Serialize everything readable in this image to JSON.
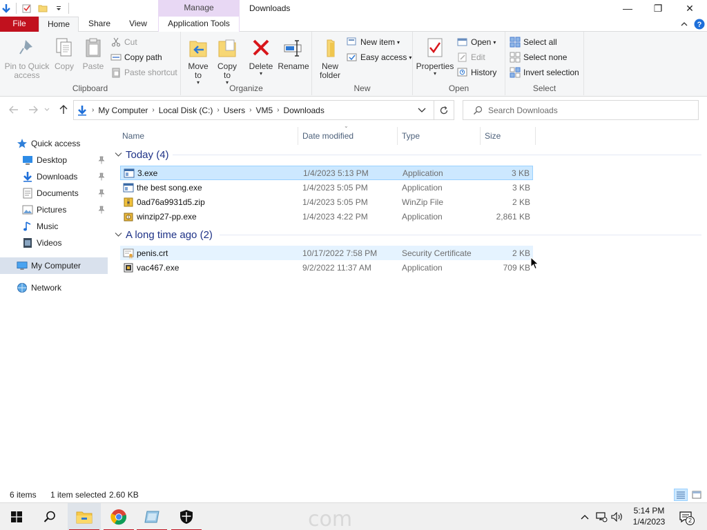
{
  "window": {
    "title": "Downloads",
    "context_tab": "Manage",
    "minimize": "—",
    "maximize": "❐",
    "close": "✕"
  },
  "tabs": {
    "file": "File",
    "home": "Home",
    "share": "Share",
    "view": "View",
    "app_tools": "Application Tools"
  },
  "ribbon": {
    "clipboard": {
      "label": "Clipboard",
      "pin": "Pin to Quick access",
      "copy": "Copy",
      "paste": "Paste",
      "cut": "Cut",
      "copy_path": "Copy path",
      "paste_shortcut": "Paste shortcut"
    },
    "organize": {
      "label": "Organize",
      "move_to": "Move to",
      "copy_to": "Copy to",
      "delete": "Delete",
      "rename": "Rename"
    },
    "new": {
      "label": "New",
      "new_folder": "New folder",
      "new_item": "New item",
      "easy_access": "Easy access"
    },
    "open": {
      "label": "Open",
      "properties": "Properties",
      "open": "Open",
      "edit": "Edit",
      "history": "History"
    },
    "select": {
      "label": "Select",
      "select_all": "Select all",
      "select_none": "Select none",
      "invert": "Invert selection"
    }
  },
  "address": {
    "crumbs": [
      "My Computer",
      "Local Disk (C:)",
      "Users",
      "VM5",
      "Downloads"
    ],
    "search_placeholder": "Search Downloads"
  },
  "nav": {
    "quick_access": "Quick access",
    "desktop": "Desktop",
    "downloads": "Downloads",
    "documents": "Documents",
    "pictures": "Pictures",
    "music": "Music",
    "videos": "Videos",
    "my_computer": "My Computer",
    "network": "Network"
  },
  "columns": {
    "name": "Name",
    "date": "Date modified",
    "type": "Type",
    "size": "Size"
  },
  "groups": [
    {
      "title": "Today (4)",
      "files": [
        {
          "name": "3.exe",
          "date": "1/4/2023 5:13 PM",
          "type": "Application",
          "size": "3 KB"
        },
        {
          "name": "the best song.exe",
          "date": "1/4/2023 5:05 PM",
          "type": "Application",
          "size": "3 KB"
        },
        {
          "name": "0ad76a9931d5.zip",
          "date": "1/4/2023 5:05 PM",
          "type": "WinZip File",
          "size": "2 KB"
        },
        {
          "name": "winzip27-pp.exe",
          "date": "1/4/2023 4:22 PM",
          "type": "Application",
          "size": "2,861 KB"
        }
      ]
    },
    {
      "title": "A long time ago (2)",
      "files": [
        {
          "name": "penis.crt",
          "date": "10/17/2022 7:58 PM",
          "type": "Security Certificate",
          "size": "2 KB"
        },
        {
          "name": "vac467.exe",
          "date": "9/2/2022 11:37 AM",
          "type": "Application",
          "size": "709 KB"
        }
      ]
    }
  ],
  "status": {
    "count": "6 items",
    "selected": "1 item selected",
    "size": "2.60 KB"
  },
  "taskbar": {
    "watermark": "com",
    "time": "5:14 PM",
    "date": "1/4/2023",
    "notifications": "2"
  }
}
